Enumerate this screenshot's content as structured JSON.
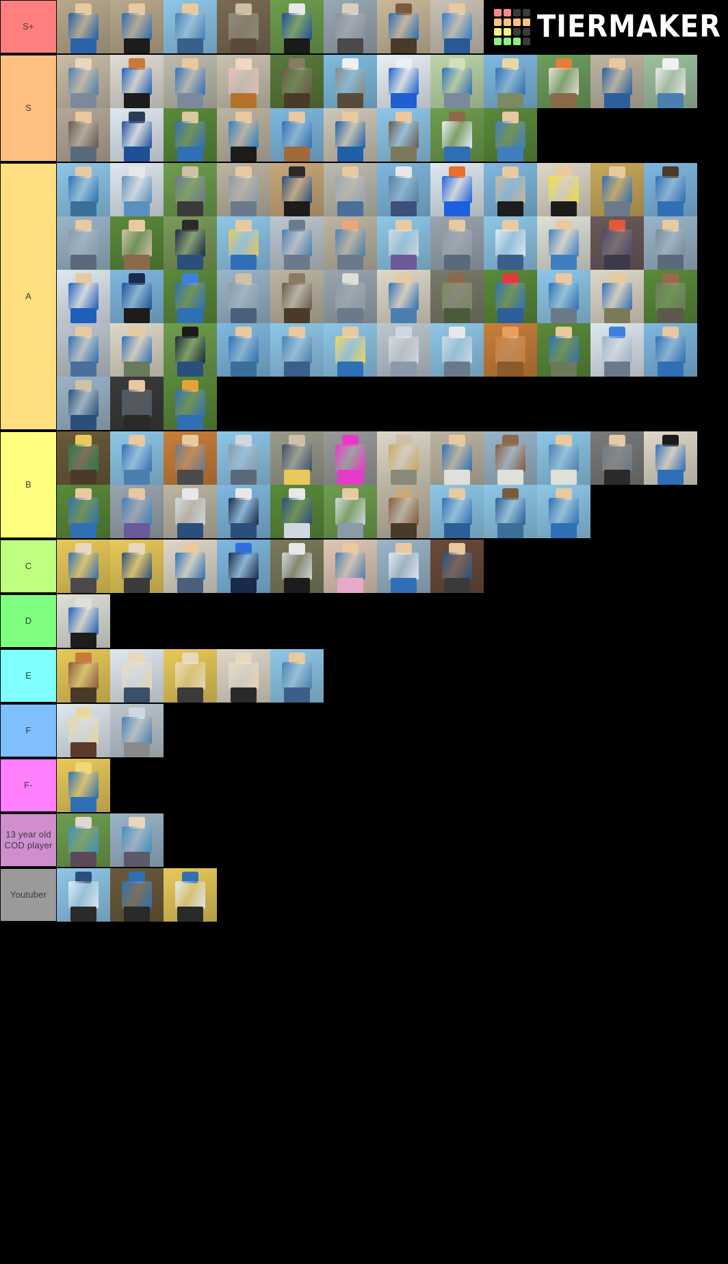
{
  "app": {
    "brand": "TIERMAKER",
    "brand_icon": "tiermaker-grid-logo",
    "background_color": "#000000"
  },
  "watermark": {
    "grid_colors": [
      "#f98a8a",
      "#f98a8a",
      "#3b3b3b",
      "#3b3b3b",
      "#f8c27f",
      "#f8c27f",
      "#f8c27f",
      "#f8c27f",
      "#f9f47e",
      "#f9f47e",
      "#3b3b3b",
      "#3b3b3b",
      "#8ef07e",
      "#8ef07e",
      "#8ef07e",
      "#3b3b3b"
    ]
  },
  "tiers": [
    {
      "label": "S+",
      "color": "#ff7f7f",
      "text_color": "#3a3a3a",
      "item_count": 8,
      "items": [
        {
          "bg": "#b9a98c",
          "shirt": "#1f5fa8",
          "legs": "#2a63a8",
          "head": "#e8c9a0"
        },
        {
          "bg": "#b9a98c",
          "shirt": "#2a6bb5",
          "legs": "#1c1c1c",
          "head": "#e8c9a0"
        },
        {
          "bg": "#8ec7e8",
          "shirt": "#4a7fb5",
          "legs": "#3a5f8a",
          "head": "#e8c9a0"
        },
        {
          "bg": "#7a6a52",
          "shirt": "#8a8a7a",
          "legs": "#5a4a3a",
          "head": "#cdbfa6"
        },
        {
          "bg": "#6e9e4e",
          "shirt": "#1f4f9a",
          "legs": "#1a1a1a",
          "head": "#e8e8e8"
        },
        {
          "bg": "#9aa8b5",
          "shirt": "#8a8f96",
          "legs": "#4a4a4a",
          "head": "#d9cfc0"
        },
        {
          "bg": "#c9b89a",
          "shirt": "#2a6bb5",
          "legs": "#4a3a2a",
          "head": "#7a5a3a"
        },
        {
          "bg": "#c9c2b5",
          "shirt": "#2f7ec9",
          "legs": "#2a5a96",
          "head": "#e8c9a0"
        }
      ]
    },
    {
      "label": "S",
      "color": "#ffbf7f",
      "text_color": "#3a3a3a",
      "item_count": 21,
      "items": [
        {
          "bg": "#c9bda8",
          "shirt": "#4a7fb0",
          "legs": "#7a8a9a",
          "head": "#e8d8bc"
        },
        {
          "bg": "#e0ddd6",
          "shirt": "#1f5fbb",
          "legs": "#1c1c1c",
          "head": "#c9793a"
        },
        {
          "bg": "#bdbcae",
          "shirt": "#2f6fc0",
          "legs": "#7a8a9a",
          "head": "#e8c9a0"
        },
        {
          "bg": "#c9c2b0",
          "shirt": "#e8bcbc",
          "legs": "#b5722a",
          "head": "#f0d8bc"
        },
        {
          "bg": "#5a7a3a",
          "shirt": "#6a5a46",
          "legs": "#4a3a2a",
          "head": "#8a7a62"
        },
        {
          "bg": "#7fbde0",
          "shirt": "#8a8a8a",
          "legs": "#5a4a3a",
          "head": "#f0f0f0"
        },
        {
          "bg": "#e8f0f6",
          "shirt": "#1f5fcf",
          "legs": "#1f5fcf",
          "head": "#e8f0f6"
        },
        {
          "bg": "#bdd6a8",
          "shirt": "#2f6fb5",
          "legs": "#7a8a9a",
          "head": "#cfe0bc"
        },
        {
          "bg": "#7fb8e0",
          "shirt": "#2f6fb5",
          "legs": "#7a8a62",
          "head": "#e8d8a0"
        },
        {
          "bg": "#6e9e5e",
          "shirt": "#e8e0d0",
          "legs": "#8a6a4a",
          "head": "#e07f3a"
        },
        {
          "bg": "#bdb5a2",
          "shirt": "#2a5f9a",
          "legs": "#2a5f9a",
          "head": "#e8c9a0"
        },
        {
          "bg": "#9ec0a0",
          "shirt": "#e8e8e8",
          "legs": "#4a7fb0",
          "head": "#f0f0f0"
        },
        {
          "bg": "#b5a898",
          "shirt": "#6a5a4a",
          "legs": "#5a6a7a",
          "head": "#e8c9a0"
        },
        {
          "bg": "#dfe8f0",
          "shirt": "#1f4f9a",
          "legs": "#1f4f9a",
          "head": "#2a3a5a"
        },
        {
          "bg": "#5a8a3a",
          "shirt": "#2f6fb5",
          "legs": "#2f6fb5",
          "head": "#d8c9a0"
        },
        {
          "bg": "#bdb5a2",
          "shirt": "#2f7ec0",
          "legs": "#1c1c1c",
          "head": "#e8c9a0"
        },
        {
          "bg": "#7fb8e0",
          "shirt": "#2f6fb5",
          "legs": "#a06a3a",
          "head": "#e8c9a0"
        },
        {
          "bg": "#cfc7b5",
          "shirt": "#1f5fa8",
          "legs": "#1f5fa8",
          "head": "#e8c9a0"
        },
        {
          "bg": "#8ec7e8",
          "shirt": "#6a5a4a",
          "legs": "#7a7a5a",
          "head": "#e8c9a0"
        },
        {
          "bg": "#6e9e4e",
          "shirt": "#e8f0f8",
          "legs": "#2f6fb5",
          "head": "#8a6a4a"
        },
        {
          "bg": "#5a8a3a",
          "shirt": "#3f7fc0",
          "legs": "#3f7fc0",
          "head": "#e8c9a0"
        }
      ]
    },
    {
      "label": "A",
      "color": "#ffdf7f",
      "text_color": "#3a3a3a",
      "item_count": 51,
      "items": [
        {
          "bg": "#8ec7e8",
          "shirt": "#2f6fb5",
          "legs": "#3a6f9a",
          "head": "#e8c9a0"
        },
        {
          "bg": "#dfe8f0",
          "shirt": "#5a8fc0",
          "legs": "#5a8fc0",
          "head": "#e8e8e8"
        },
        {
          "bg": "#6e9e4e",
          "shirt": "#6a7a8a",
          "legs": "#3a3a3a",
          "head": "#cfc0a8"
        },
        {
          "bg": "#bdb5a2",
          "shirt": "#8a9aa8",
          "legs": "#6a7a8a",
          "head": "#e8c9a0"
        },
        {
          "bg": "#c9a87a",
          "shirt": "#2a4f7a",
          "legs": "#1c1c1c",
          "head": "#2a2a2a"
        },
        {
          "bg": "#bdbcae",
          "shirt": "#9aa5b0",
          "legs": "#4a6f9a",
          "head": "#e8c9a0"
        },
        {
          "bg": "#7fb8e0",
          "shirt": "#5a7f9a",
          "legs": "#3a4f7a",
          "head": "#e8e8e8"
        },
        {
          "bg": "#dfe8f0",
          "shirt": "#1f5fdf",
          "legs": "#1f5fdf",
          "head": "#e8702a"
        },
        {
          "bg": "#7fb8e0",
          "shirt": "#c9b89a",
          "legs": "#1c1c1c",
          "head": "#e8c9a0"
        },
        {
          "bg": "#dfd8c9",
          "shirt": "#f0e03a",
          "legs": "#1c1c1c",
          "head": "#e8c9a0"
        },
        {
          "bg": "#c9a85a",
          "shirt": "#2f6fb5",
          "legs": "#6a7a8a",
          "head": "#e8c9a0"
        },
        {
          "bg": "#7fb8e0",
          "shirt": "#2f6fb5",
          "legs": "#2f6fb5",
          "head": "#4a3a2a"
        },
        {
          "bg": "#9ab5c9",
          "shirt": "#8a9aa8",
          "legs": "#5a6a7a",
          "head": "#e8c9a0"
        },
        {
          "bg": "#5a8a3a",
          "shirt": "#cfc0a8",
          "legs": "#8a6a4a",
          "head": "#e8c9a0"
        },
        {
          "bg": "#7a9a5a",
          "shirt": "#1a2a4a",
          "legs": "#2a4f7a",
          "head": "#2a2a2a"
        },
        {
          "bg": "#8ec7e8",
          "shirt": "#e8c95a",
          "legs": "#2f6fb5",
          "head": "#e8c9a0"
        },
        {
          "bg": "#bdc7cf",
          "shirt": "#4a7fb0",
          "legs": "#6a7a8a",
          "head": "#6a7a8a"
        },
        {
          "bg": "#bdb5a2",
          "shirt": "#4a7fb0",
          "legs": "#6a7a8a",
          "head": "#e8a87a"
        },
        {
          "bg": "#8ec7e8",
          "shirt": "#cfd8e0",
          "legs": "#6a5a9a",
          "head": "#e8c9a0"
        },
        {
          "bg": "#9aa5b0",
          "shirt": "#8a9aa8",
          "legs": "#5a6a7a",
          "head": "#e8c9a0"
        },
        {
          "bg": "#8ec7e8",
          "shirt": "#dfe8f0",
          "legs": "#3a5f8a",
          "head": "#e8c9a0"
        },
        {
          "bg": "#dfe0d8",
          "shirt": "#3f7fc0",
          "legs": "#3f7fc0",
          "head": "#e8c9a0"
        },
        {
          "bg": "#6a5a5a",
          "shirt": "#4a4a6a",
          "legs": "#3a3a4a",
          "head": "#e05a3a"
        },
        {
          "bg": "#9ab5c9",
          "shirt": "#7a8a9a",
          "legs": "#5a6a7a",
          "head": "#e8c9a0"
        },
        {
          "bg": "#dfe8f0",
          "shirt": "#1f5fbb",
          "legs": "#1f5fbb",
          "head": "#e8c9a0"
        },
        {
          "bg": "#7fb8e0",
          "shirt": "#1f4f9a",
          "legs": "#1c1c1c",
          "head": "#1a2a4a"
        },
        {
          "bg": "#5a8a3a",
          "shirt": "#2f6fb5",
          "legs": "#2f6fb5",
          "head": "#3f7fdf"
        },
        {
          "bg": "#9ab5c9",
          "shirt": "#8a9aa8",
          "legs": "#4a5f7a",
          "head": "#cfc0a8"
        },
        {
          "bg": "#bdb5a2",
          "shirt": "#6a5a4a",
          "legs": "#4a3a2a",
          "head": "#8a7a62"
        },
        {
          "bg": "#9aa5b0",
          "shirt": "#8a9aa8",
          "legs": "#6a7a8a",
          "head": "#dfe0d8"
        },
        {
          "bg": "#dfd8c9",
          "shirt": "#2f6fb5",
          "legs": "#4a7fb0",
          "head": "#e8c9a0"
        },
        {
          "bg": "#7a7a6a",
          "shirt": "#7a8a5a",
          "legs": "#4a5a3a",
          "head": "#8a6a4a"
        },
        {
          "bg": "#5a8a3a",
          "shirt": "#2f6fb5",
          "legs": "#2a5f9a",
          "head": "#e03a3a"
        },
        {
          "bg": "#8ec7e8",
          "shirt": "#2f6fb5",
          "legs": "#6a7a8a",
          "head": "#e8c9a0"
        },
        {
          "bg": "#dfd8c9",
          "shirt": "#2f6fb5",
          "legs": "#7a7a5a",
          "head": "#e8c9a0"
        },
        {
          "bg": "#5a8a3a",
          "shirt": "#6a7a5a",
          "legs": "#5a5a4a",
          "head": "#9a6a4a"
        },
        {
          "bg": "#bdc7cf",
          "shirt": "#2f6fb5",
          "legs": "#4a6f9a",
          "head": "#e8c9a0"
        },
        {
          "bg": "#dfd8c9",
          "shirt": "#2f6fb5",
          "legs": "#6a7a5a",
          "head": "#e8c9a0"
        },
        {
          "bg": "#6e9e4e",
          "shirt": "#1a2a3a",
          "legs": "#2a4f7a",
          "head": "#1a1a1a"
        },
        {
          "bg": "#7fb8e0",
          "shirt": "#2f6fb5",
          "legs": "#3a6f9a",
          "head": "#e8c9a0"
        },
        {
          "bg": "#8ec7e8",
          "shirt": "#4a7fb0",
          "legs": "#3a5f8a",
          "head": "#e8c9a0"
        },
        {
          "bg": "#8ec7e8",
          "shirt": "#f0d85a",
          "legs": "#2f6fb5",
          "head": "#e8c9a0"
        },
        {
          "bg": "#bdc7cf",
          "shirt": "#cfd8e0",
          "legs": "#8a9aa8",
          "head": "#cfd8e0"
        },
        {
          "bg": "#8ec7e8",
          "shirt": "#cfd8e0",
          "legs": "#6a7a8a",
          "head": "#e8e8e8"
        },
        {
          "bg": "#c97f3a",
          "shirt": "#c97f3a",
          "legs": "#8a5a2a",
          "head": "#e8a05a"
        },
        {
          "bg": "#5a8a3a",
          "shirt": "#2f6fb5",
          "legs": "#6a7a5a",
          "head": "#e8c9a0"
        },
        {
          "bg": "#dfe8f0",
          "shirt": "#9ab5c9",
          "legs": "#6a7a8a",
          "head": "#3f7fdf"
        },
        {
          "bg": "#7fb8e0",
          "shirt": "#2f6fb5",
          "legs": "#2f6fb5",
          "head": "#e8c9a0"
        },
        {
          "bg": "#9ab5c9",
          "shirt": "#2a4f7a",
          "legs": "#2a4f7a",
          "head": "#cfc0a8"
        },
        {
          "bg": "#3a3a3a",
          "shirt": "#4a5a6a",
          "legs": "#2a2a2a",
          "head": "#e8c9a0"
        },
        {
          "bg": "#5a8a3a",
          "shirt": "#2f6fb5",
          "legs": "#2f6fb5",
          "head": "#e8a03a"
        }
      ]
    },
    {
      "label": "B",
      "color": "#ffff7f",
      "text_color": "#3a3a3a",
      "item_count": 22,
      "items": [
        {
          "bg": "#6a5a3a",
          "shirt": "#2a7a4a",
          "legs": "#4a3a2a",
          "head": "#e8c95a"
        },
        {
          "bg": "#8ec7e8",
          "shirt": "#2f6fb5",
          "legs": "#4a7fb0",
          "head": "#e8c9a0"
        },
        {
          "bg": "#c97f3a",
          "shirt": "#6a7a8a",
          "legs": "#4a4a4a",
          "head": "#e8c9a0"
        },
        {
          "bg": "#8ec7e8",
          "shirt": "#8a9aa8",
          "legs": "#5a6a7a",
          "head": "#cfd8e0"
        },
        {
          "bg": "#9a9a8a",
          "shirt": "#3a4f6a",
          "legs": "#e8c95a",
          "head": "#cfc0a8"
        },
        {
          "bg": "#9a9a9a",
          "shirt": "#e83ac9",
          "legs": "#e83ac9",
          "head": "#e83ac9"
        },
        {
          "bg": "#dfd8c9",
          "shirt": "#c9a85a",
          "legs": "#8a8a7a",
          "head": "#cfc0a8"
        },
        {
          "bg": "#bdb5a2",
          "shirt": "#2f6fb5",
          "legs": "#dfe0d8",
          "head": "#e8c9a0"
        },
        {
          "bg": "#9ab5c9",
          "shirt": "#8a5a3a",
          "legs": "#dfe0d8",
          "head": "#8a6a4a"
        },
        {
          "bg": "#8ec7e8",
          "shirt": "#4a7fb0",
          "legs": "#dfe0d8",
          "head": "#e8c9a0"
        },
        {
          "bg": "#7a7a7a",
          "shirt": "#6a7a8a",
          "legs": "#2a2a2a",
          "head": "#e8c9a0"
        },
        {
          "bg": "#dfd8c9",
          "shirt": "#2f6fb5",
          "legs": "#2f6fb5",
          "head": "#1a1a1a"
        },
        {
          "bg": "#5a8a3a",
          "shirt": "#2f6fb5",
          "legs": "#2f6fb5",
          "head": "#e8c9a0"
        },
        {
          "bg": "#9aa5b0",
          "shirt": "#3f7fc0",
          "legs": "#6a5a9a",
          "head": "#e8c9a0"
        },
        {
          "bg": "#bdb5a2",
          "shirt": "#cfd8e0",
          "legs": "#2a4f7a",
          "head": "#e8e8e8"
        },
        {
          "bg": "#7fb8e0",
          "shirt": "#1a2a4a",
          "legs": "#2a4f7a",
          "head": "#e8e8e8"
        },
        {
          "bg": "#5a8a3a",
          "shirt": "#2a4f7a",
          "legs": "#cfd8e0",
          "head": "#e8e8e8"
        },
        {
          "bg": "#6e9e4e",
          "shirt": "#cfd8e0",
          "legs": "#8a9aa8",
          "head": "#e8c9a0"
        },
        {
          "bg": "#bdb5a2",
          "shirt": "#8a5a3a",
          "legs": "#4a3a2a",
          "head": "#c9a87a"
        },
        {
          "bg": "#8ec7e8",
          "shirt": "#2f6fb5",
          "legs": "#2a5f9a",
          "head": "#e8c9a0"
        },
        {
          "bg": "#8ec7e8",
          "shirt": "#2a5f9a",
          "legs": "#3a6f9a",
          "head": "#7a5a3a"
        },
        {
          "bg": "#8ec7e8",
          "shirt": "#2f6fb5",
          "legs": "#2f6fb5",
          "head": "#e8c9a0"
        }
      ]
    },
    {
      "label": "C",
      "color": "#bfff7f",
      "text_color": "#3a3a3a",
      "item_count": 8,
      "items": [
        {
          "bg": "#e8c95a",
          "shirt": "#2f6fb5",
          "legs": "#4a4a4a",
          "head": "#e8d8bc"
        },
        {
          "bg": "#e8c95a",
          "shirt": "#2a4f7a",
          "legs": "#3a3a3a",
          "head": "#e8d8bc"
        },
        {
          "bg": "#dfd8c9",
          "shirt": "#2f6fb5",
          "legs": "#4a5f7a",
          "head": "#e8c9a0"
        },
        {
          "bg": "#7fb8e0",
          "shirt": "#1a2a4a",
          "legs": "#1a2a4a",
          "head": "#2f6fdf"
        },
        {
          "bg": "#7a7a5a",
          "shirt": "#cfd8e0",
          "legs": "#1c1c1c",
          "head": "#e8e8e8"
        },
        {
          "bg": "#dfc7b5",
          "shirt": "#4a7fb0",
          "legs": "#e8a8c9",
          "head": "#e8c9a0"
        },
        {
          "bg": "#9ab5c9",
          "shirt": "#dfe8f0",
          "legs": "#2f6fb5",
          "head": "#e8c9a0"
        },
        {
          "bg": "#6a4a3a",
          "shirt": "#2a4f7a",
          "legs": "#3a3a3a",
          "head": "#e8c9a0"
        }
      ]
    },
    {
      "label": "D",
      "color": "#7fff7f",
      "text_color": "#3a3a3a",
      "item_count": 1,
      "items": [
        {
          "bg": "#dfe0d8",
          "shirt": "#1f5fbb",
          "legs": "#1c1c1c",
          "head": "#dfe0d8"
        }
      ]
    },
    {
      "label": "E",
      "color": "#7fffff",
      "text_color": "#3a3a3a",
      "item_count": 5,
      "items": [
        {
          "bg": "#e8c95a",
          "shirt": "#8a5a3a",
          "legs": "#4a3a2a",
          "head": "#c9793a"
        },
        {
          "bg": "#dfe8f0",
          "shirt": "#e8d8bc",
          "legs": "#3a4f6a",
          "head": "#e8d8bc"
        },
        {
          "bg": "#e8c95a",
          "shirt": "#e8d8bc",
          "legs": "#3a3a3a",
          "head": "#e8d8bc"
        },
        {
          "bg": "#dfd8c9",
          "shirt": "#e8d8bc",
          "legs": "#2a2a2a",
          "head": "#e8d8bc"
        },
        {
          "bg": "#8ec7e8",
          "shirt": "#4a7fb0",
          "legs": "#3a5f8a",
          "head": "#e8c9a0"
        }
      ]
    },
    {
      "label": "F",
      "color": "#7fbfff",
      "text_color": "#3a3a3a",
      "item_count": 2,
      "items": [
        {
          "bg": "#dfe8f0",
          "shirt": "#e8d8a0",
          "legs": "#5a3a2a",
          "head": "#e8d8a0"
        },
        {
          "bg": "#bdc7cf",
          "shirt": "#4a7fb0",
          "legs": "#8a8a8a",
          "head": "#cfd8e0"
        }
      ]
    },
    {
      "label": "F-",
      "color": "#ff7fff",
      "text_color": "#3a3a3a",
      "item_count": 1,
      "items": [
        {
          "bg": "#e8c95a",
          "shirt": "#2f6fb5",
          "legs": "#2f6fb5",
          "head": "#f0d87a"
        }
      ]
    },
    {
      "label": "13 year old COD player",
      "color": "#cf8fcf",
      "text_color": "#3a3a3a",
      "item_count": 2,
      "items": [
        {
          "bg": "#6e9e4e",
          "shirt": "#3f8fc0",
          "legs": "#5a4a5a",
          "head": "#dfd8d0"
        },
        {
          "bg": "#9ab5c9",
          "shirt": "#3f8fc0",
          "legs": "#5a5a6a",
          "head": "#e8d8bc"
        }
      ]
    },
    {
      "label": "Youtuber",
      "color": "#9a9a9a",
      "text_color": "#3a3a3a",
      "item_count": 3,
      "items": [
        {
          "bg": "#8ec7e8",
          "shirt": "#dfe8f0",
          "legs": "#2a2a2a",
          "head": "#2a4f7a"
        },
        {
          "bg": "#6a5a3a",
          "shirt": "#2f6fb5",
          "legs": "#2a2a2a",
          "head": "#2f6fb5"
        },
        {
          "bg": "#e8c95a",
          "shirt": "#dfe8f0",
          "legs": "#2a2a2a",
          "head": "#2f6fb5"
        }
      ]
    }
  ]
}
